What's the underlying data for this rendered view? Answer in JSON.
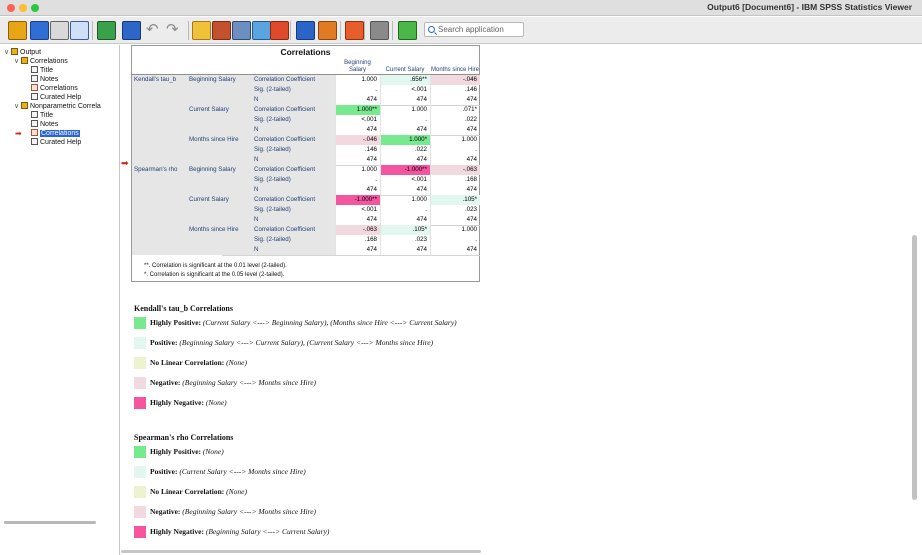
{
  "window": {
    "title": "Output6 [Document6] - IBM SPSS Statistics Viewer"
  },
  "toolbar": {
    "search_placeholder": "Search application",
    "icons": [
      "open-icon",
      "save-icon",
      "print-icon",
      "print-preview-icon",
      "export-icon",
      "recall-dialog-icon",
      "undo-icon",
      "redo-icon",
      "goto-data-icon",
      "goto-case-icon",
      "variables-icon",
      "insert-cases-icon",
      "split-file-icon",
      "select-cases-icon",
      "value-labels-icon",
      "designate-window-icon",
      "show-hide-icon",
      "toggle-icon"
    ]
  },
  "outline": {
    "items": [
      {
        "label": "Output",
        "level": 0,
        "icon": "output-book-icon"
      },
      {
        "label": "Correlations",
        "level": 1,
        "icon": "book-icon"
      },
      {
        "label": "Title",
        "level": 2,
        "icon": "title-icon"
      },
      {
        "label": "Notes",
        "level": 2,
        "icon": "notes-icon"
      },
      {
        "label": "Correlations",
        "level": 2,
        "icon": "table-icon"
      },
      {
        "label": "Curated Help",
        "level": 2,
        "icon": "help-icon"
      },
      {
        "label": "Nonparametric Correla",
        "level": 1,
        "icon": "book-icon"
      },
      {
        "label": "Title",
        "level": 2,
        "icon": "title-icon"
      },
      {
        "label": "Notes",
        "level": 2,
        "icon": "notes-icon"
      },
      {
        "label": "Correlations",
        "level": 2,
        "icon": "table-icon",
        "selected": true
      },
      {
        "label": "Curated Help",
        "level": 2,
        "icon": "help-icon"
      }
    ]
  },
  "table": {
    "title": "Correlations",
    "col_headers": [
      "Beginning Salary",
      "Current Salary",
      "Months since Hire"
    ],
    "rows": [
      {
        "g": "Kendall's tau_b",
        "v": "Beginning Salary",
        "s": "Correlation Coefficient",
        "c": [
          "1.000",
          ".656**",
          "-.046"
        ]
      },
      {
        "g": "",
        "v": "",
        "s": "Sig. (2-tailed)",
        "c": [
          ".",
          "<.001",
          ".146"
        ]
      },
      {
        "g": "",
        "v": "",
        "s": "N",
        "c": [
          "474",
          "474",
          "474"
        ]
      },
      {
        "g": "",
        "v": "Current Salary",
        "s": "Correlation Coefficient",
        "c": [
          "1.000**",
          "1.000",
          ".071*"
        ]
      },
      {
        "g": "",
        "v": "",
        "s": "Sig. (2-tailed)",
        "c": [
          "<.001",
          ".",
          ".022"
        ]
      },
      {
        "g": "",
        "v": "",
        "s": "N",
        "c": [
          "474",
          "474",
          "474"
        ]
      },
      {
        "g": "",
        "v": "Months since Hire",
        "s": "Correlation Coefficient",
        "c": [
          "-.046",
          "1.000*",
          "1.000"
        ]
      },
      {
        "g": "",
        "v": "",
        "s": "Sig. (2-tailed)",
        "c": [
          ".146",
          ".022",
          "."
        ]
      },
      {
        "g": "",
        "v": "",
        "s": "N",
        "c": [
          "474",
          "474",
          "474"
        ]
      },
      {
        "g": "Spearman's rho",
        "v": "Beginning Salary",
        "s": "Correlation Coefficient",
        "c": [
          "1.000",
          "-1.000**",
          "-.063"
        ]
      },
      {
        "g": "",
        "v": "",
        "s": "Sig. (2-tailed)",
        "c": [
          ".",
          "<.001",
          ".168"
        ]
      },
      {
        "g": "",
        "v": "",
        "s": "N",
        "c": [
          "474",
          "474",
          "474"
        ]
      },
      {
        "g": "",
        "v": "Current Salary",
        "s": "Correlation Coefficient",
        "c": [
          "-1.000**",
          "1.000",
          ".105*"
        ]
      },
      {
        "g": "",
        "v": "",
        "s": "Sig. (2-tailed)",
        "c": [
          "<.001",
          ".",
          ".023"
        ]
      },
      {
        "g": "",
        "v": "",
        "s": "N",
        "c": [
          "474",
          "474",
          "474"
        ]
      },
      {
        "g": "",
        "v": "Months since Hire",
        "s": "Correlation Coefficient",
        "c": [
          "-.063",
          ".105*",
          "1.000"
        ]
      },
      {
        "g": "",
        "v": "",
        "s": "Sig. (2-tailed)",
        "c": [
          ".168",
          ".023",
          "."
        ]
      },
      {
        "g": "",
        "v": "",
        "s": "N",
        "c": [
          "474",
          "474",
          "474"
        ]
      }
    ],
    "highlights": [
      {
        "row": 0,
        "col": 1,
        "color": "#e3f7f1"
      },
      {
        "row": 0,
        "col": 2,
        "color": "#f2d9df"
      },
      {
        "row": 3,
        "col": 0,
        "color": "#79e98f"
      },
      {
        "row": 6,
        "col": 0,
        "color": "#f2d9df"
      },
      {
        "row": 6,
        "col": 1,
        "color": "#79e98f"
      },
      {
        "row": 9,
        "col": 1,
        "color": "#f4559f"
      },
      {
        "row": 9,
        "col": 2,
        "color": "#f2d9df"
      },
      {
        "row": 12,
        "col": 0,
        "color": "#f4559f"
      },
      {
        "row": 12,
        "col": 2,
        "color": "#e3f7f1"
      },
      {
        "row": 15,
        "col": 0,
        "color": "#f2d9df"
      },
      {
        "row": 15,
        "col": 1,
        "color": "#e3f7f1"
      }
    ],
    "footnotes": [
      "**. Correlation is significant at the 0.01 level (2-tailed).",
      "*. Correlation is significant at the 0.05 level (2-tailed)."
    ]
  },
  "legend": {
    "sections": [
      {
        "heading": "Kendall's tau_b Correlations",
        "items": [
          {
            "label": "Highly Positive:",
            "text": "(Current Salary <---> Beginning Salary), (Months since Hire <---> Current Salary)",
            "color": "#79e98f"
          },
          {
            "label": "Positive:",
            "text": "(Beginning Salary <---> Current Salary), (Current Salary <---> Months since Hire)",
            "color": "#e3f7f1"
          },
          {
            "label": "No Linear Correlation:",
            "text": "(None)",
            "color": "#eef3cf"
          },
          {
            "label": "Negative:",
            "text": "(Beginning Salary <---> Months since Hire)",
            "color": "#f2d9df"
          },
          {
            "label": "Highly Negative:",
            "text": "(None)",
            "color": "#f4559f"
          }
        ]
      },
      {
        "heading": "Spearman's rho Correlations",
        "items": [
          {
            "label": "Highly Positive:",
            "text": "(None)",
            "color": "#79e98f"
          },
          {
            "label": "Positive:",
            "text": "(Current Salary <---> Months since Hire)",
            "color": "#e3f7f1"
          },
          {
            "label": "No Linear Correlation:",
            "text": "(None)",
            "color": "#eef3cf"
          },
          {
            "label": "Negative:",
            "text": "(Beginning Salary <---> Months since Hire)",
            "color": "#f2d9df"
          },
          {
            "label": "Highly Negative:",
            "text": "(Beginning Salary <---> Current Salary)",
            "color": "#f4559f"
          }
        ]
      }
    ]
  }
}
